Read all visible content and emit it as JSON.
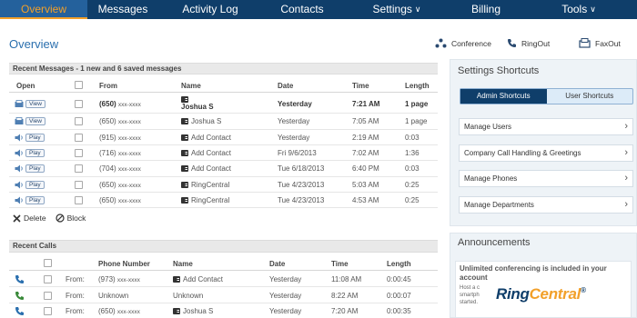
{
  "nav": {
    "items": [
      {
        "label": "Overview",
        "active": true,
        "caret": false
      },
      {
        "label": "Messages",
        "active": false,
        "caret": false
      },
      {
        "label": "Activity Log",
        "active": false,
        "caret": false
      },
      {
        "label": "Contacts",
        "active": false,
        "caret": false
      },
      {
        "label": "Settings",
        "active": false,
        "caret": true
      },
      {
        "label": "Billing",
        "active": false,
        "caret": false
      },
      {
        "label": "Tools",
        "active": false,
        "caret": true
      }
    ],
    "caret_glyph": "∨"
  },
  "page": {
    "title": "Overview",
    "actions": {
      "conference": "Conference",
      "ringout": "RingOut",
      "faxout": "FaxOut"
    }
  },
  "messages": {
    "header": "Recent Messages - 1 new and 6 saved messages",
    "columns": {
      "open": "Open",
      "from": "From",
      "name": "Name",
      "date": "Date",
      "time": "Time",
      "length": "Length"
    },
    "rows": [
      {
        "action": "View",
        "type": "fax",
        "from_num": "(650)",
        "from_rest": "xxx-xxxx",
        "name": "Joshua S",
        "name_stacked": true,
        "date": "Yesterday",
        "time": "7:21 AM",
        "length": "1 page",
        "bold": true
      },
      {
        "action": "View",
        "type": "fax",
        "from_num": "(650)",
        "from_rest": "xxx-xxxx",
        "name": "Joshua S",
        "name_stacked": false,
        "date": "Yesterday",
        "time": "7:05 AM",
        "length": "1 page",
        "bold": false
      },
      {
        "action": "Play",
        "type": "voice",
        "from_num": "(915)",
        "from_rest": "xxx-xxxx",
        "name": "Add Contact",
        "name_stacked": false,
        "date": "Yesterday",
        "time": "2:19 AM",
        "length": "0:03",
        "bold": false
      },
      {
        "action": "Play",
        "type": "voice",
        "from_num": "(716)",
        "from_rest": "xxx-xxxx",
        "name": "Add Contact",
        "name_stacked": false,
        "date": "Fri 9/6/2013",
        "time": "7:02 AM",
        "length": "1:36",
        "bold": false
      },
      {
        "action": "Play",
        "type": "voice",
        "from_num": "(704)",
        "from_rest": "xxx-xxxx",
        "name": "Add Contact",
        "name_stacked": false,
        "date": "Tue 6/18/2013",
        "time": "6:40 PM",
        "length": "0:03",
        "bold": false
      },
      {
        "action": "Play",
        "type": "voice",
        "from_num": "(650)",
        "from_rest": "xxx-xxxx",
        "name": "RingCentral",
        "name_stacked": false,
        "date": "Tue 4/23/2013",
        "time": "5:03 AM",
        "length": "0:25",
        "bold": false
      },
      {
        "action": "Play",
        "type": "voice",
        "from_num": "(650)",
        "from_rest": "xxx-xxxx",
        "name": "RingCentral",
        "name_stacked": false,
        "date": "Tue 4/23/2013",
        "time": "4:53 AM",
        "length": "0:25",
        "bold": false
      }
    ],
    "delete_label": "Delete",
    "block_label": "Block"
  },
  "calls": {
    "header": "Recent Calls",
    "columns": {
      "phone": "Phone Number",
      "name": "Name",
      "date": "Date",
      "time": "Time",
      "length": "Length"
    },
    "rows": [
      {
        "dir": "From:",
        "phone_num": "(973)",
        "phone_rest": "xxx-xxxx",
        "name": "Add Contact",
        "name_icon": true,
        "date": "Yesterday",
        "time": "11:08 AM",
        "length": "0:00:45",
        "icon_color": "#2a6fae"
      },
      {
        "dir": "From:",
        "phone_num": "Unknown",
        "phone_rest": "",
        "name": "Unknown",
        "name_icon": false,
        "date": "Yesterday",
        "time": "8:22 AM",
        "length": "0:00:07",
        "icon_color": "#3a8a3a"
      },
      {
        "dir": "From:",
        "phone_num": "(650)",
        "phone_rest": "xxx-xxxx",
        "name": "Joshua S",
        "name_icon": true,
        "date": "Yesterday",
        "time": "7:20 AM",
        "length": "0:00:35",
        "icon_color": "#2a6fae"
      }
    ]
  },
  "settings": {
    "title": "Settings Shortcuts",
    "tabs": [
      {
        "label": "Admin Shortcuts",
        "active": true
      },
      {
        "label": "User Shortcuts",
        "active": false
      }
    ],
    "items": [
      "Manage Users",
      "Company Call Handling & Greetings",
      "Manage Phones",
      "Manage Departments"
    ],
    "chevron": "›"
  },
  "announcements": {
    "title": "Announcements",
    "headline": "Unlimited conferencing is included in your account",
    "body_lines": [
      "Host a c",
      "smartph",
      "started."
    ],
    "logo_text_main": "Ring",
    "logo_text_accent": "Central",
    "logo_reg": "®"
  },
  "colors": {
    "nav_bg": "#0f3e6a",
    "nav_active": "#f2a02a",
    "accent_blue": "#2a6fae"
  }
}
